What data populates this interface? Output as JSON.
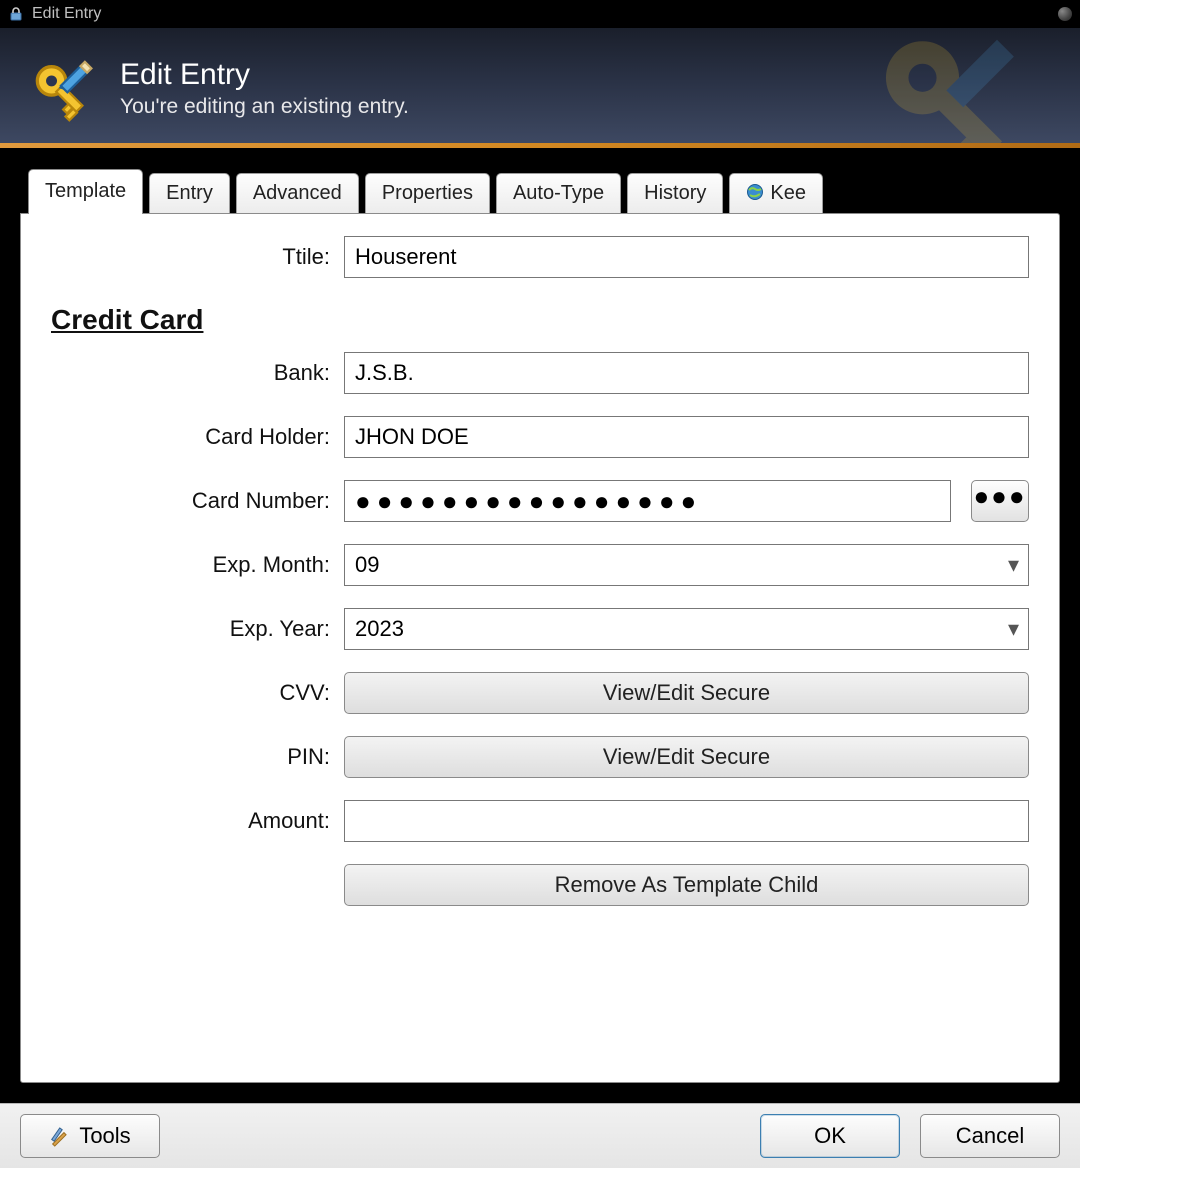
{
  "window": {
    "title": "Edit Entry"
  },
  "header": {
    "title": "Edit Entry",
    "subtitle": "You're editing an existing entry."
  },
  "tabs": [
    {
      "label": "Template",
      "active": true
    },
    {
      "label": "Entry"
    },
    {
      "label": "Advanced"
    },
    {
      "label": "Properties"
    },
    {
      "label": "Auto-Type"
    },
    {
      "label": "History"
    },
    {
      "label": "Kee",
      "icon": "globe"
    }
  ],
  "form": {
    "title_label": "Ttile:",
    "title_value": "Houserent",
    "section": "Credit Card",
    "bank_label": "Bank:",
    "bank_value": "J.S.B.",
    "holder_label": "Card Holder:",
    "holder_value": "JHON DOE",
    "number_label": "Card Number:",
    "number_mask": "●●●●●●●●●●●●●●●●",
    "expm_label": "Exp. Month:",
    "expm_value": "09",
    "expy_label": "Exp. Year:",
    "expy_value": "2023",
    "cvv_label": "CVV:",
    "cvv_button": "View/Edit Secure",
    "pin_label": "PIN:",
    "pin_button": "View/Edit Secure",
    "amount_label": "Amount:",
    "amount_value": "",
    "remove_template_button": "Remove As Template Child",
    "reveal_dots": "●●●"
  },
  "footer": {
    "tools": "Tools",
    "ok": "OK",
    "cancel": "Cancel"
  }
}
